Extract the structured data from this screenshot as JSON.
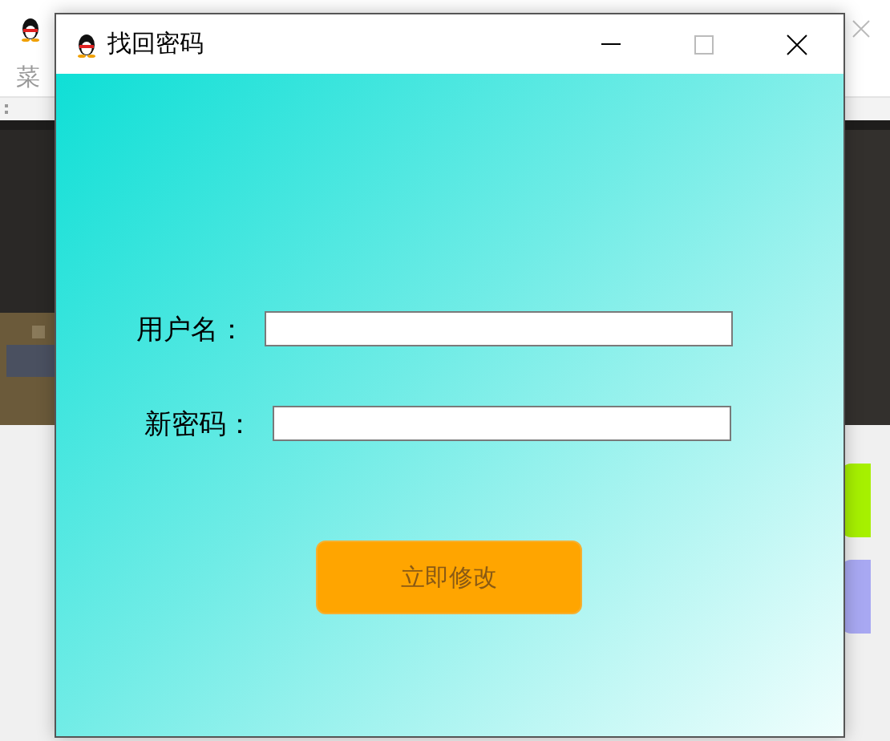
{
  "background_window": {
    "menu": [
      "菜"
    ],
    "side_buttons": [
      {
        "color": "#a6f000"
      },
      {
        "color": "#a8a8f2"
      }
    ]
  },
  "dialog": {
    "title": "找回密码",
    "fields": [
      {
        "label": "用户名："
      },
      {
        "label": "新密码："
      }
    ],
    "submit_button": "立即修改"
  }
}
